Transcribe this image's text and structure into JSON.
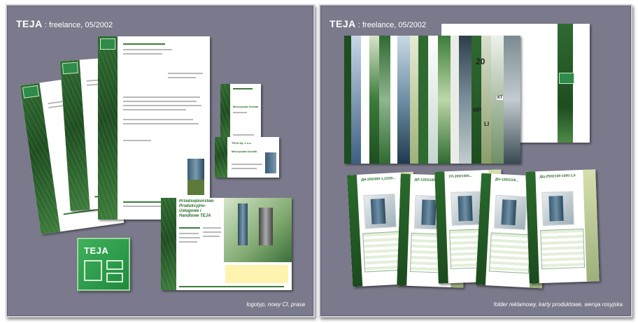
{
  "left_panel": {
    "title_brand": "TEJA",
    "title_rest": ": freelance, 05/2002",
    "caption": "logotyp, nowy CI, prasa",
    "logo_text": "TEJA",
    "ad_headline": "Przedsiębiorstwo Produkcyjno-Usługowe i Handlowe TEJA",
    "card_name_1": "Mieczysław Dvořák",
    "card_name_2": "Mieczysław Dvořák",
    "card_brand": "TEJA Sp. z o.o."
  },
  "right_panel": {
    "title_brand": "TEJA",
    "title_rest": ": freelance, 05/2002",
    "caption": "folder reklamowy, karty produktowe, wersja rosyjska",
    "product_titles": [
      "ДН-250/300-1,1/220...",
      "ДЛ-125/2100-1000-1,5",
      "УП-200/1300...",
      "ДН-125/2100...",
      "ДЦ-250/2100-1000-1,5"
    ],
    "folder_marks": [
      "20",
      "MP",
      "LI",
      "КТ"
    ]
  },
  "colors": {
    "panel_bg": "#7b7a8c",
    "brand_green": "#2e8b4a",
    "dark_green": "#1e4d20"
  }
}
